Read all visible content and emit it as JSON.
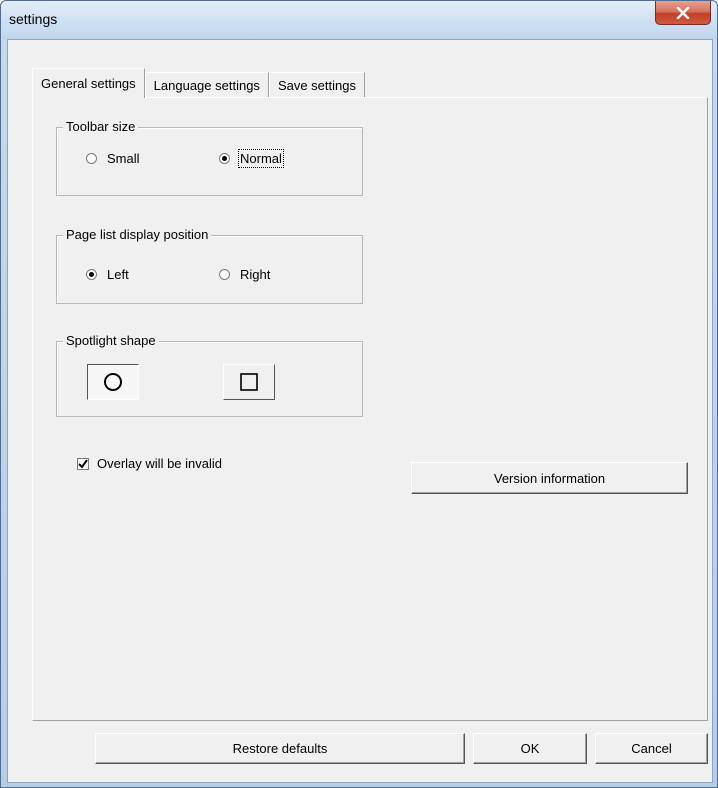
{
  "window": {
    "title": "settings"
  },
  "tabs": [
    {
      "label": "General settings",
      "active": true
    },
    {
      "label": "Language settings",
      "active": false
    },
    {
      "label": "Save settings",
      "active": false
    }
  ],
  "toolbar_size": {
    "legend": "Toolbar size",
    "options": [
      {
        "label": "Small",
        "checked": false
      },
      {
        "label": "Normal",
        "checked": true
      }
    ]
  },
  "page_list_position": {
    "legend": "Page list display position",
    "options": [
      {
        "label": "Left",
        "checked": true
      },
      {
        "label": "Right",
        "checked": false
      }
    ]
  },
  "spotlight_shape": {
    "legend": "Spotlight shape",
    "options": [
      {
        "icon": "circle-icon",
        "selected": true
      },
      {
        "icon": "square-icon",
        "selected": false
      }
    ]
  },
  "overlay_checkbox": {
    "label": "Overlay will be invalid",
    "checked": true
  },
  "buttons": {
    "version_info": "Version information",
    "restore_defaults": "Restore defaults",
    "ok": "OK",
    "cancel": "Cancel"
  },
  "colors": {
    "close_button": "#c0402a",
    "dialog_background": "#f0f0f0",
    "frame": "#c6d9ef"
  }
}
